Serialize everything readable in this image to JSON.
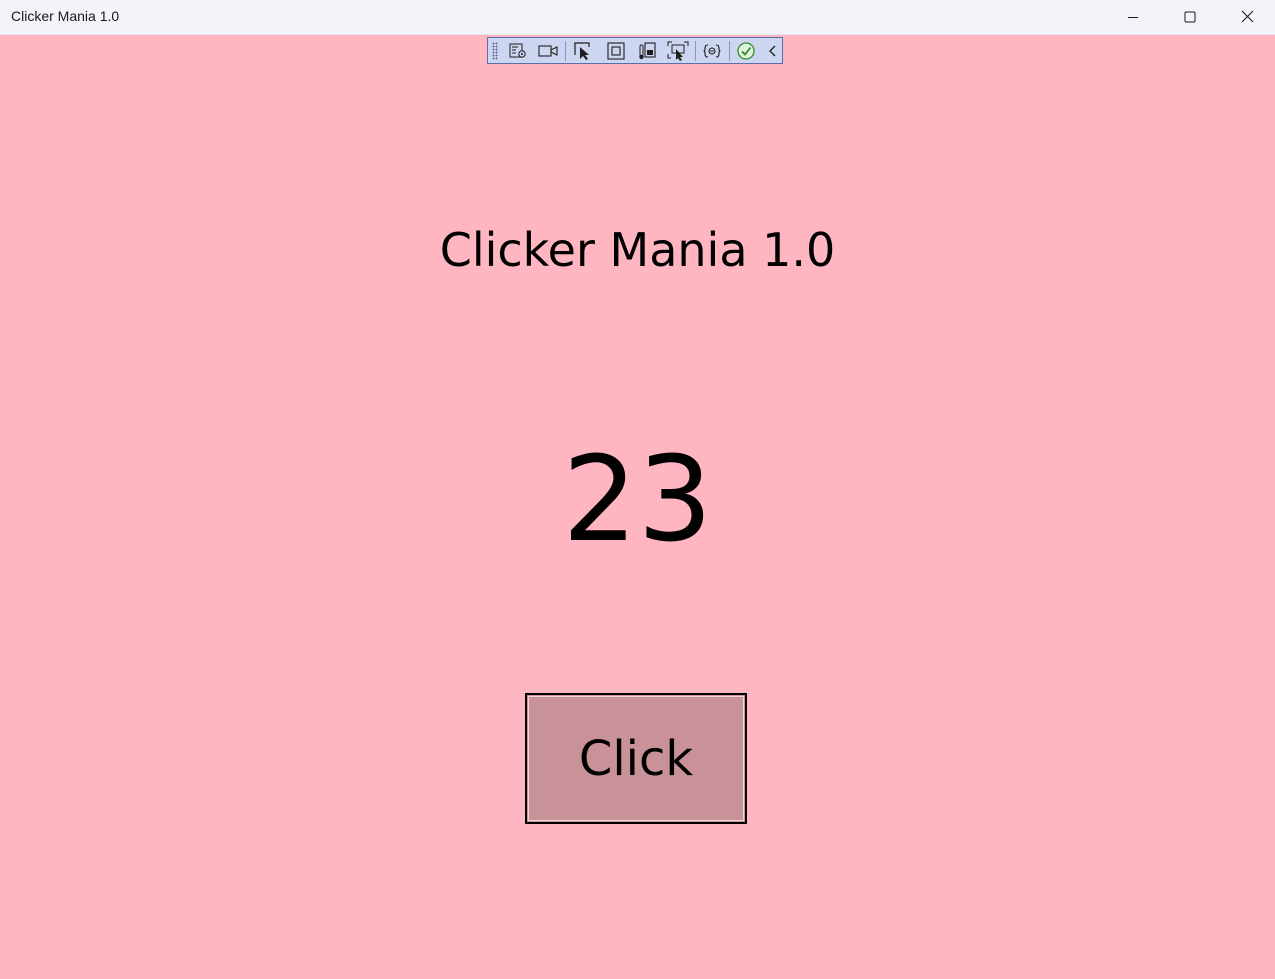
{
  "window": {
    "title": "Clicker Mania 1.0",
    "background": "#ffb6c1"
  },
  "window_controls": {
    "minimize_icon": "minimize-icon",
    "maximize_icon": "maximize-icon",
    "close_icon": "close-icon"
  },
  "debug_toolbar": {
    "tools": [
      "live-visual-tree-icon",
      "record-video-icon",
      "select-element-icon",
      "display-layout-adorners-icon",
      "track-focus-icon",
      "preview-selection-icon",
      "binding-failures-icon",
      "accessibility-check-icon",
      "collapse-chevron-icon"
    ],
    "background": "#cdd6f0"
  },
  "main": {
    "heading": "Clicker Mania 1.0",
    "count": "23",
    "button_label": "Click",
    "button_color": "#c99198"
  }
}
